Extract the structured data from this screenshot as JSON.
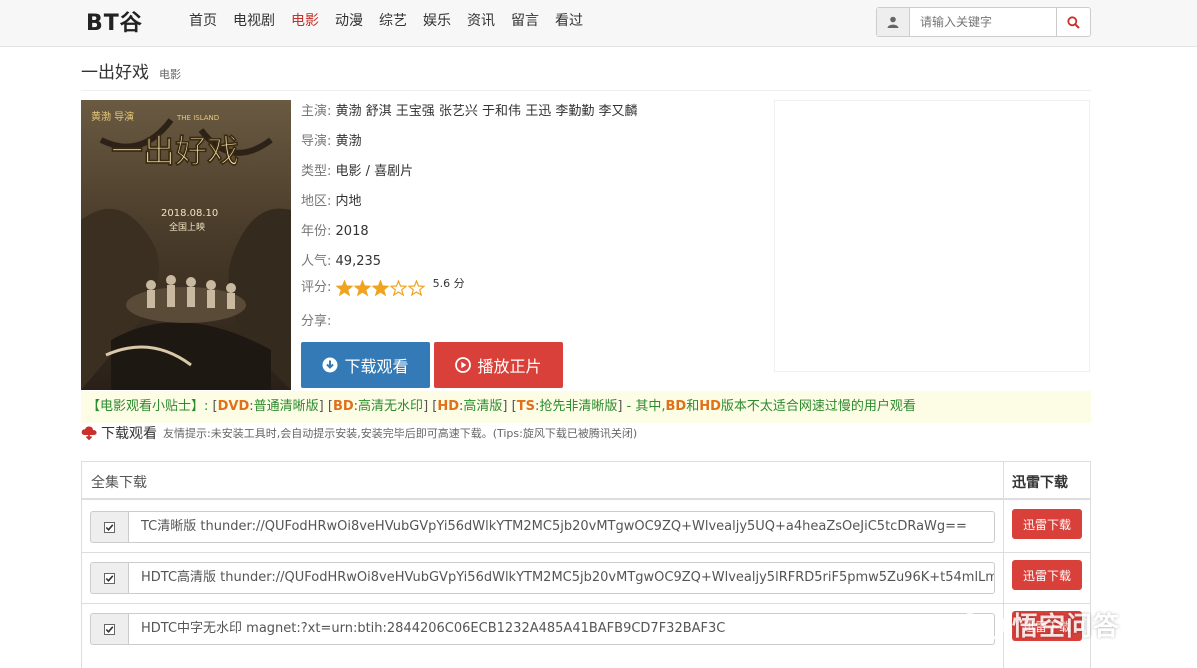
{
  "brand": {
    "logo_text": "BT谷"
  },
  "nav": {
    "items": [
      {
        "label": "首页"
      },
      {
        "label": "电视剧"
      },
      {
        "label": "电影",
        "active": true
      },
      {
        "label": "动漫"
      },
      {
        "label": "综艺"
      },
      {
        "label": "娱乐"
      },
      {
        "label": "资讯"
      },
      {
        "label": "留言"
      },
      {
        "label": "看过"
      }
    ]
  },
  "search": {
    "placeholder": "请输入关键字",
    "icon": "search-icon",
    "user_icon": "user-icon"
  },
  "movie": {
    "title": "一出好戏",
    "category": "电影",
    "actors_label": "主演:",
    "actors": "黄渤 舒淇 王宝强 张艺兴 于和伟 王迅 李勤勤 李又麟",
    "director_label": "导演:",
    "director": "黄渤",
    "genre_label": "类型:",
    "genre": "电影 / 喜剧片",
    "region_label": "地区:",
    "region": "内地",
    "year_label": "年份:",
    "year": "2018",
    "popularity_label": "人气:",
    "popularity": "49,235",
    "rating_label": "评分:",
    "rating_stars": 3,
    "rating_max": 5,
    "rating_score": "5.6 分",
    "share_label": "分享:"
  },
  "poster": {
    "director_credit": "黄渤 导演",
    "english_title": "THE ISLAND",
    "release_date": "2018.08.10",
    "release_note": "全国上映"
  },
  "buttons": {
    "download": "下载观看",
    "play": "播放正片"
  },
  "tip": {
    "head": "【电影观看小贴士】:",
    "dvd_code": "DVD",
    "dvd_text": "普通清晰版",
    "bd_code": "BD",
    "bd_text": "高清无水印",
    "hd_code": "HD",
    "hd_text": "高清版",
    "ts_code": "TS",
    "ts_text": "抢先非清晰版",
    "tail1": " - 其中,",
    "bd2": "BD",
    "and": "和",
    "hd2": "HD",
    "tail2": "版本不太适合网速过慢的用户观看"
  },
  "download_hint": {
    "label": "下载观看",
    "note": "友情提示:未安装工具时,会自动提示安装,安装完毕后即可高速下载。(Tips:旋风下载已被腾讯关闭)"
  },
  "table": {
    "col1": "全集下载",
    "col2": "迅雷下载",
    "rows": [
      {
        "text": "TC清晰版 thunder://QUFodHRwOi8veHVubGVpYi56dWlkYTM2MC5jb20vMTgwOC9ZQ+Wlvealjy5UQ+a4heaZsOeJiC5tcDRaWg==",
        "button": "迅雷下载"
      },
      {
        "text": "HDTC高清版 thunder://QUFodHRwOi8veHVubGVpYi56dWlkYTM2MC5jb20vMTgwOC9ZQ+Wlvealjy5lRFRD5riF5pmw5Zu96K+t54mlLm",
        "button": "迅雷下载"
      },
      {
        "text": "HDTC中字无水印 magnet:?xt=urn:btih:2844206C06ECB1232A485A41BAFB9CD7F32BAF3C",
        "button": "迅雷下载"
      }
    ]
  },
  "watermark": {
    "text": "悟空问答"
  },
  "colors": {
    "accent_red": "#d9403a",
    "accent_blue": "#337ab7",
    "tip_bg": "#fdfde6"
  }
}
